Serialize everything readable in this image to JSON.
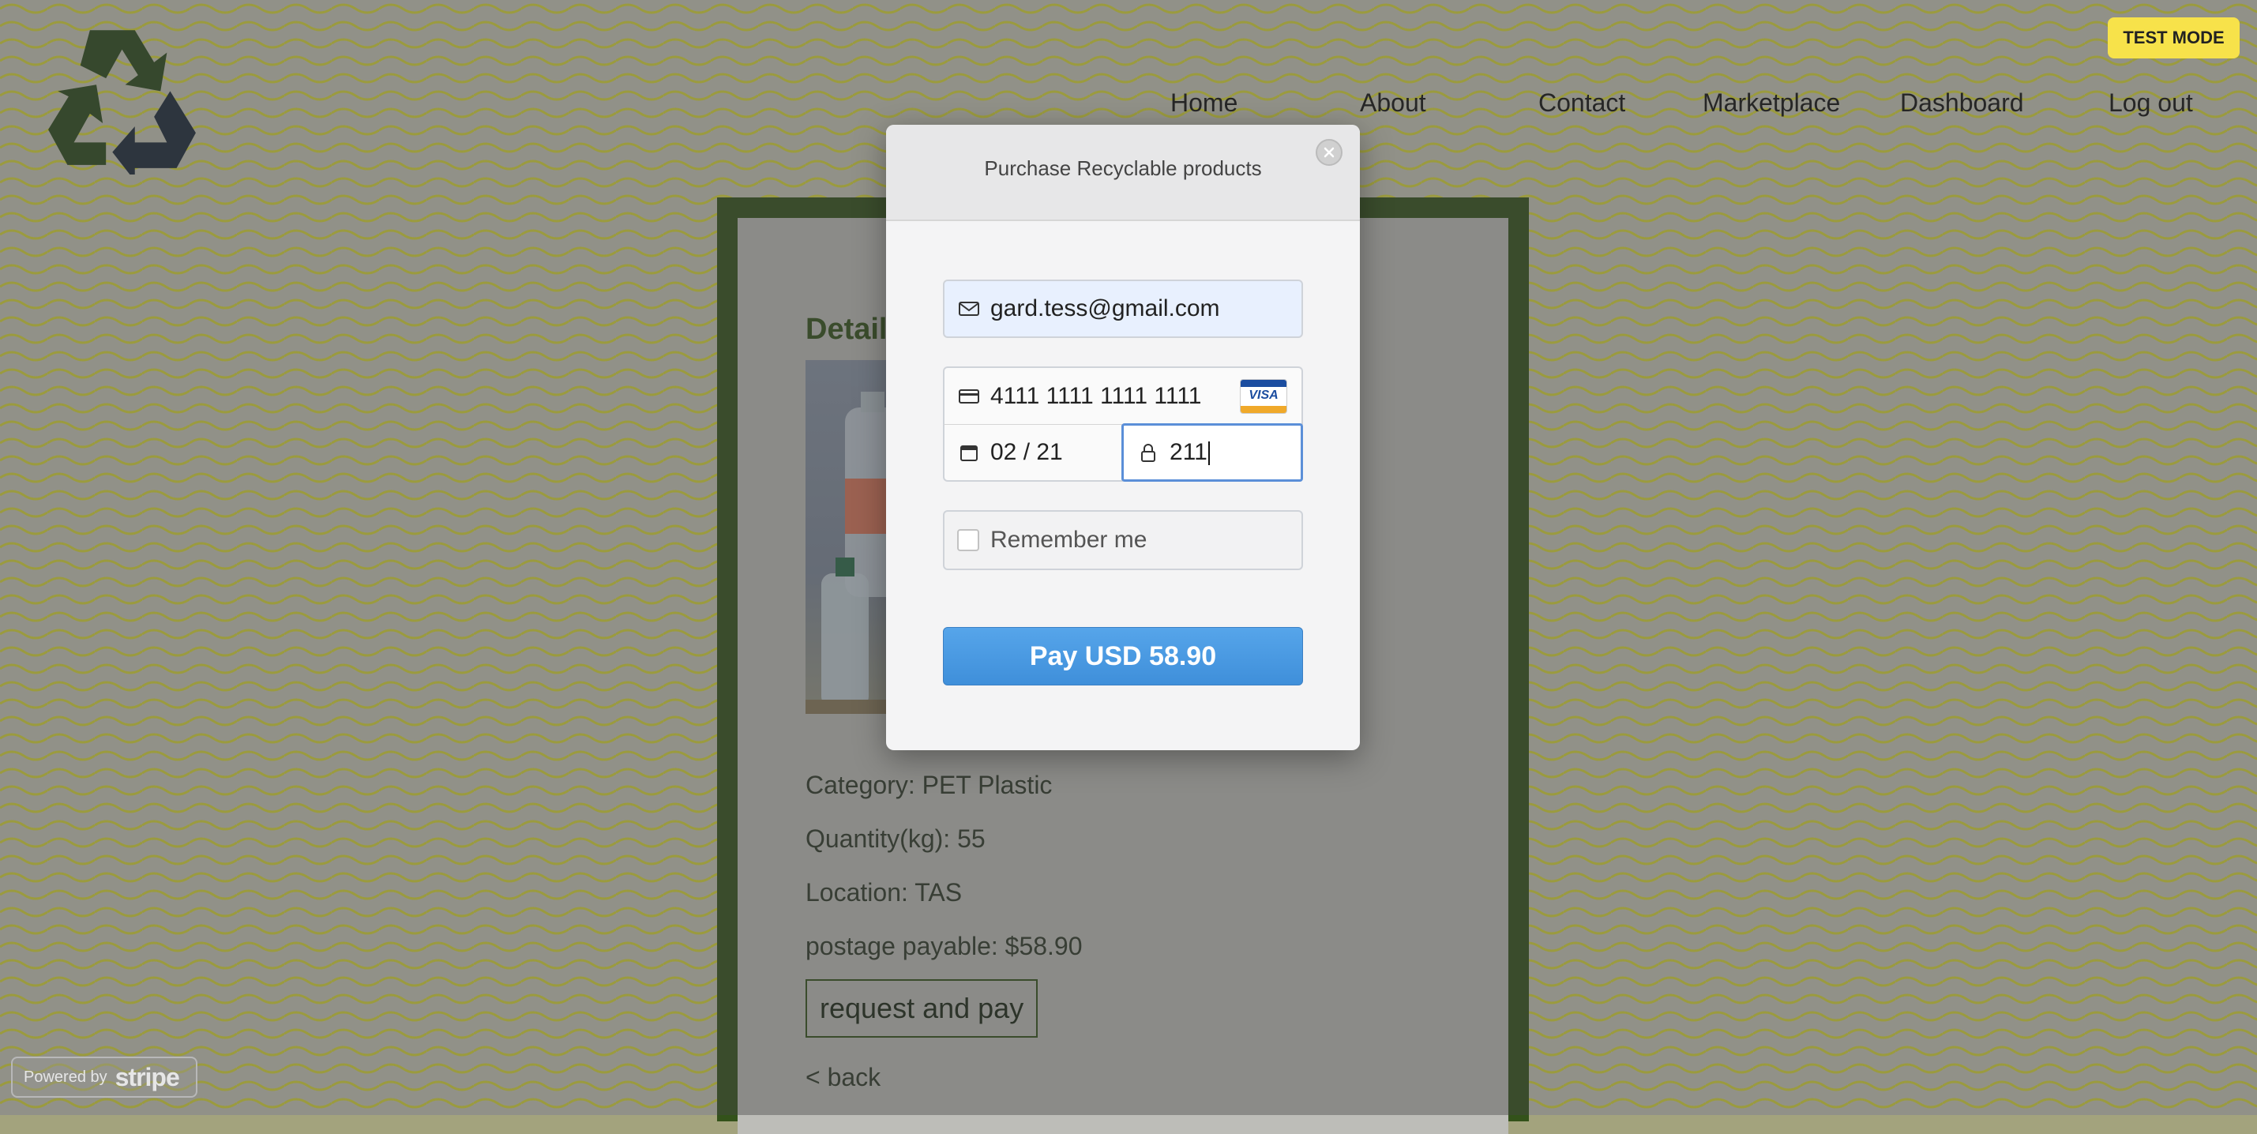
{
  "nav": {
    "items": [
      {
        "label": "Home"
      },
      {
        "label": "About"
      },
      {
        "label": "Contact"
      },
      {
        "label": "Marketplace"
      },
      {
        "label": "Dashboard"
      },
      {
        "label": "Log out"
      }
    ]
  },
  "details": {
    "title": "Details",
    "category": "Category: PET Plastic",
    "quantity": "Quantity(kg): 55",
    "location": "Location: TAS",
    "postage": "postage payable: $58.90",
    "request_button": "request and pay",
    "back_link": "< back"
  },
  "test_mode": "TEST MODE",
  "modal": {
    "title": "Purchase Recyclable products",
    "email": "gard.tess@gmail.com",
    "card_number": "4111 1111 1111 1111",
    "card_brand": "VISA",
    "expiry": "02 / 21",
    "cvc": "211",
    "remember_label": "Remember me",
    "pay_button": "Pay USD 58.90"
  },
  "powered_by": {
    "prefix": "Powered by",
    "brand": "stripe"
  },
  "colors": {
    "accent_green": "#33521a",
    "pay_blue": "#4a9ae2",
    "test_mode_yellow": "#f7e24a"
  }
}
